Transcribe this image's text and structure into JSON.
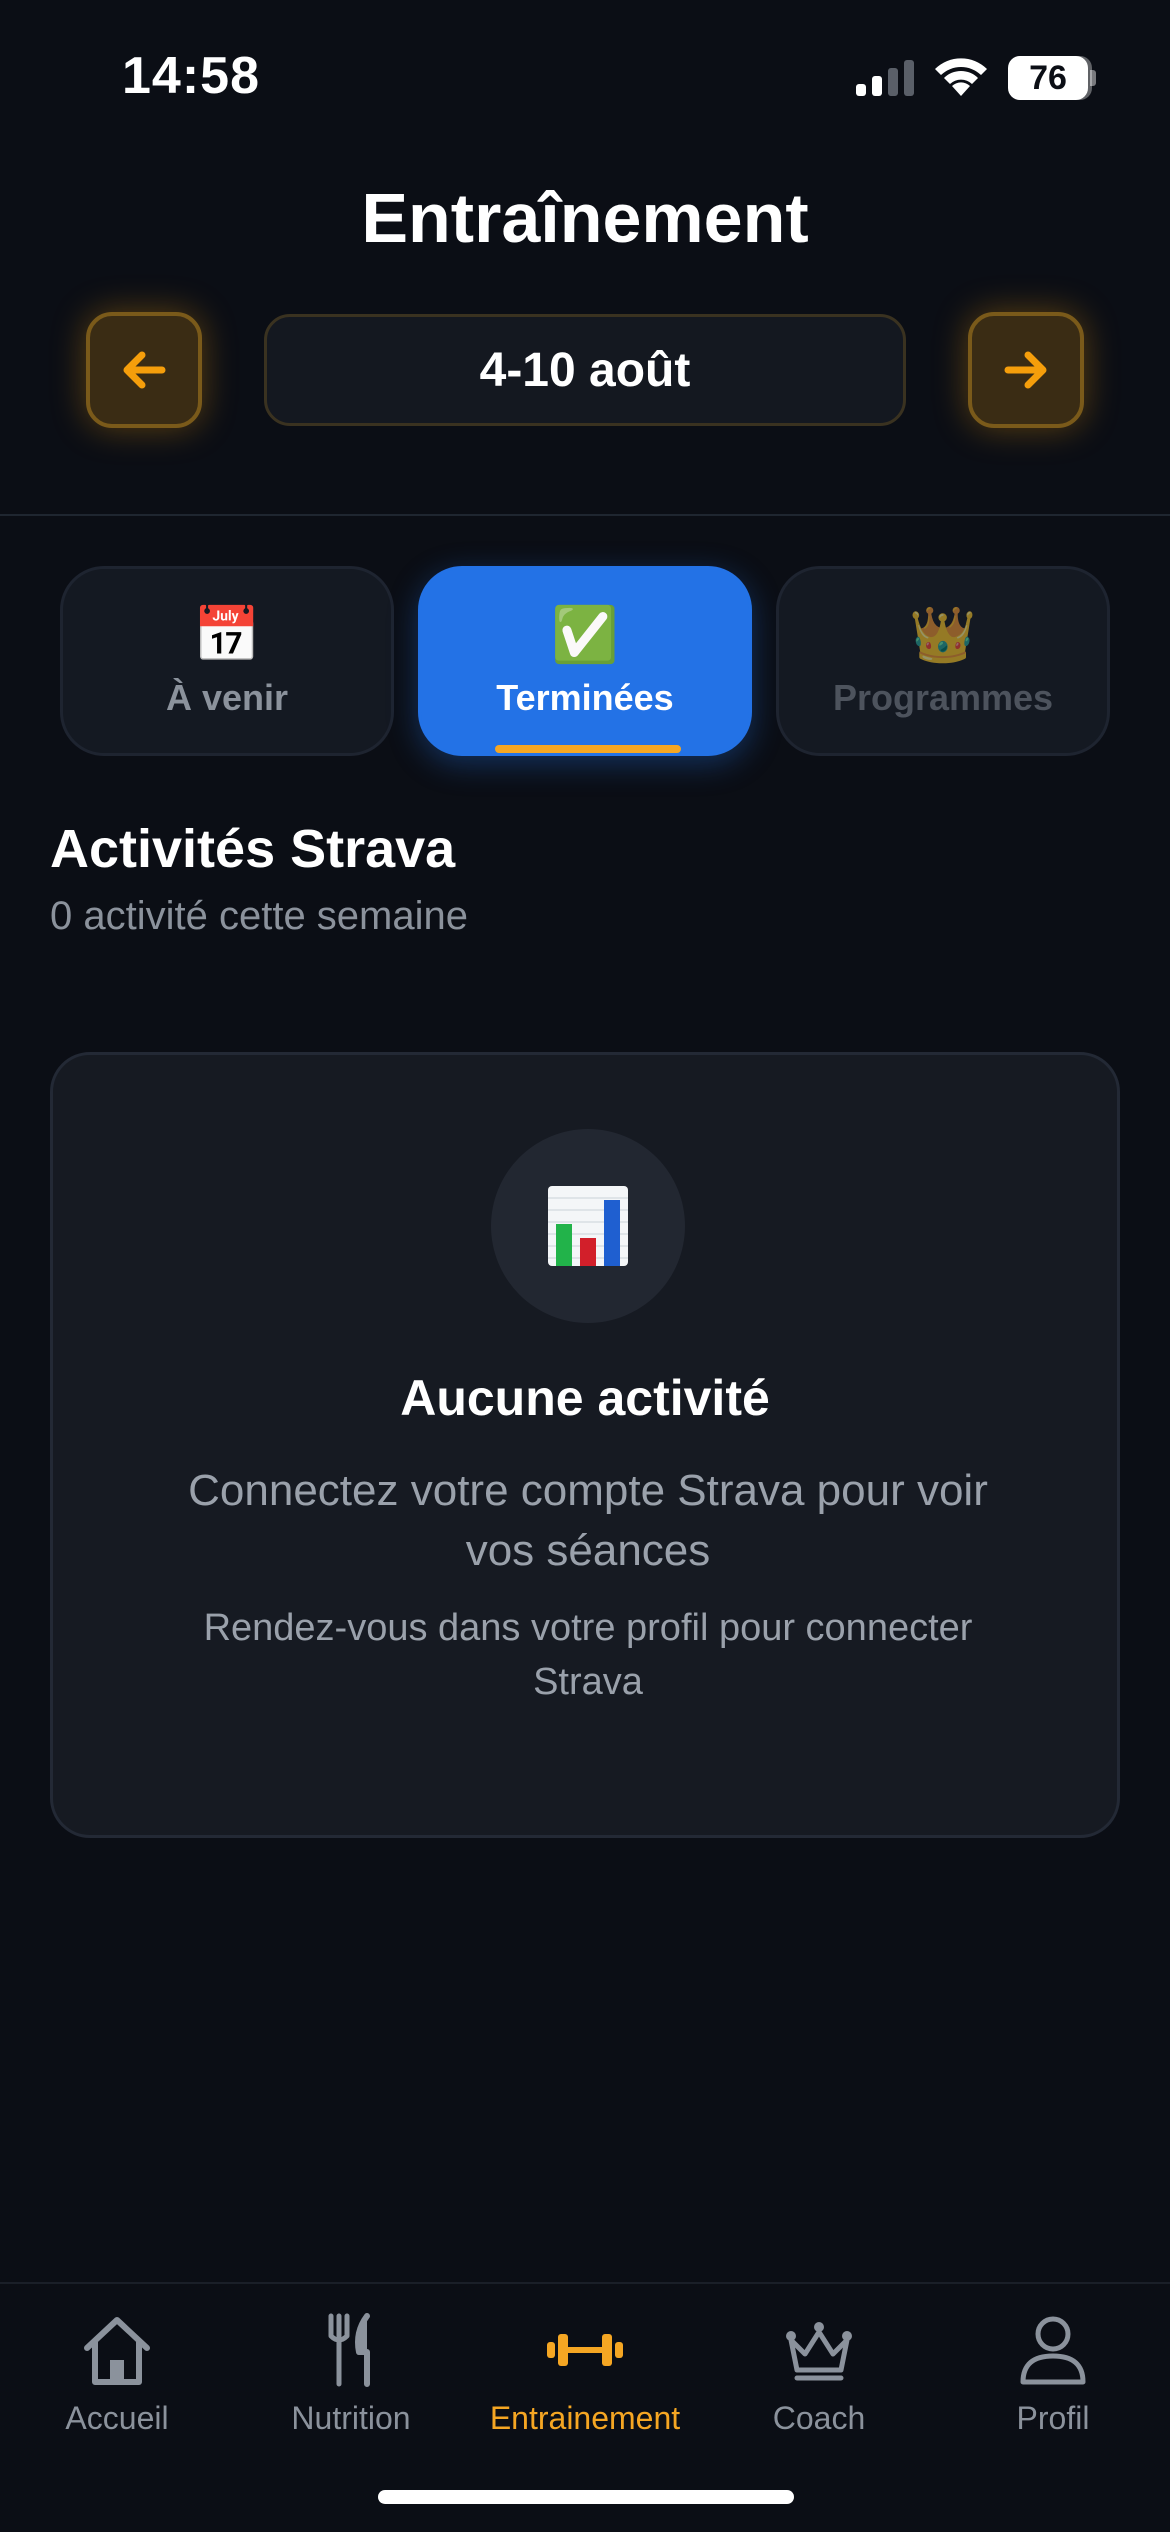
{
  "status_bar": {
    "time": "14:58",
    "battery": "76",
    "battery_level": 0.76,
    "icons": [
      "signal-icon",
      "wifi-icon",
      "battery-icon"
    ]
  },
  "header": {
    "title": "Entraînement",
    "week_label": "4-10 août",
    "prev_icon": "arrow-left-icon",
    "next_icon": "arrow-right-icon"
  },
  "tabs": [
    {
      "icon": "📅",
      "icon_name": "calendar-icon",
      "label": "À venir",
      "active": false
    },
    {
      "icon": "✅",
      "icon_name": "check-icon",
      "label": "Terminées",
      "active": true
    },
    {
      "icon": "👑",
      "icon_name": "crown-icon",
      "label": "Programmes",
      "active": false,
      "disabled": true
    }
  ],
  "section": {
    "title": "Activités Strava",
    "subtitle": "0 activité cette semaine"
  },
  "empty_state": {
    "icon": "bar-chart-icon",
    "title": "Aucune activité",
    "description": "Connectez votre compte Strava pour voir vos séances",
    "hint": "Rendez-vous dans votre profil pour connecter Strava"
  },
  "bottom_nav": [
    {
      "label": "Accueil",
      "icon": "home-icon",
      "active": false
    },
    {
      "label": "Nutrition",
      "icon": "fork-knife-icon",
      "active": false
    },
    {
      "label": "Entrainement",
      "icon": "dumbbell-icon",
      "active": true
    },
    {
      "label": "Coach",
      "icon": "crown-icon",
      "active": false
    },
    {
      "label": "Profil",
      "icon": "user-icon",
      "active": false
    }
  ],
  "colors": {
    "background": "#0b0e15",
    "accent": "#f5a623",
    "active_tab": "#2372e6",
    "muted_text": "#8b929c"
  }
}
